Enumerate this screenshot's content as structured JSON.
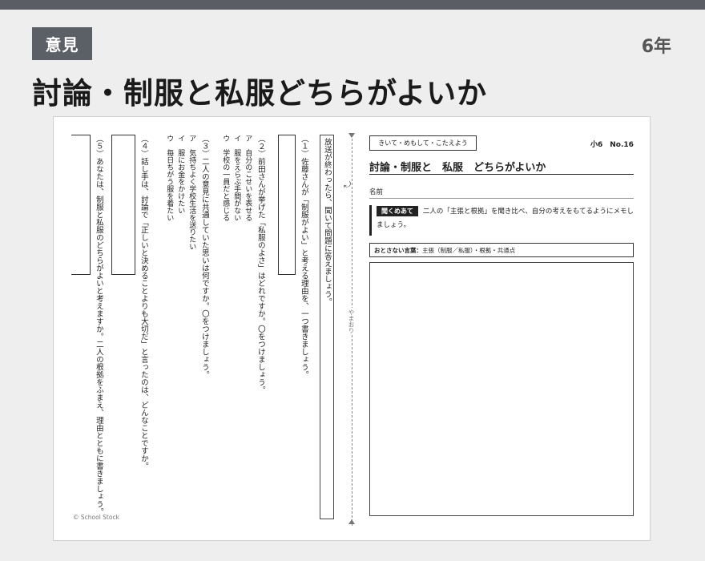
{
  "header": {
    "category_badge": "意見",
    "grade": "6年",
    "title": "討論・制服と私服どちらがよいか"
  },
  "left": {
    "instruction": "放送が終わったら、聞いて問題に答えましょう。",
    "q1": "（１）佐藤さんが「制服がよい」と考える理由を、一つ書きましょう。",
    "q2": "（２）前田さんが挙げた「私服のよさ」はどれですか。〇をつけましょう。",
    "q2_options": [
      "ア　自分のこせいを表せる",
      "イ　服をえらぶ手間がない",
      "ウ　学校の一員だと感じる"
    ],
    "q3": "（３）二人の意見に共通していた思いは何ですか。〇をつけましょう。",
    "q3_options": [
      "ア　気持ちよく学校生活を送りたい",
      "イ　服にお金をかけたい",
      "ウ　毎日ちがう服を着たい"
    ],
    "q4": "（４）話し手は、討論で「正しいと決めることよりも大切だ」と言ったのは、どんなことですか。",
    "q5": "（５）あなたは、制服と私服のどちらがよいと考えますか。二人の根拠をふまえ、理由とともに書きましょう。",
    "copyright": "© School Stock"
  },
  "fold": {
    "label": "やまおり"
  },
  "right": {
    "lesson_label": "きいて・めもして・こたえよう",
    "number": "小6　No.16",
    "title": "討論・制服と　私服　どちらがよいか",
    "name_label": "名前",
    "point_tag": "聞くめあて",
    "point_text": "二人の「主張と根拠」を聞き比べ、自分の考えをもてるようにメモしましょう。",
    "keys_label": "おとさない言葉：",
    "keys_text": "主張（制服／私服）・根拠・共通点"
  }
}
